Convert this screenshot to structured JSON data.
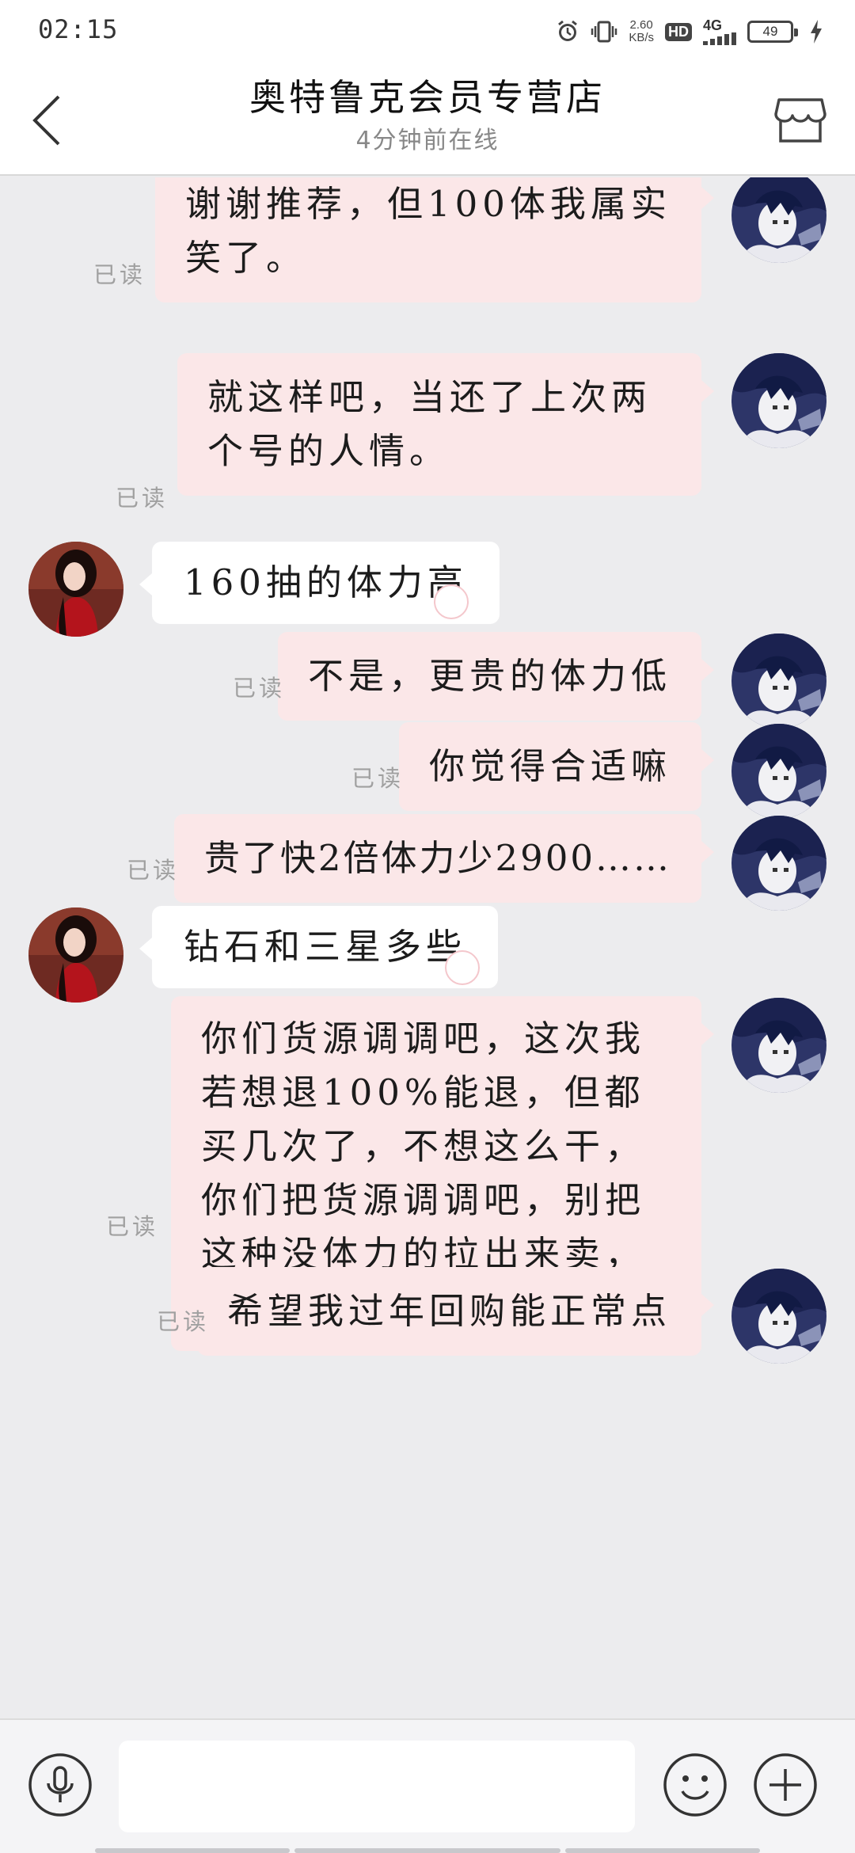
{
  "status_bar": {
    "time": "02:15",
    "net_speed_value": "2.60",
    "net_speed_unit": "KB/s",
    "hd_label": "HD",
    "network_type": "4G",
    "battery_level": "49"
  },
  "header": {
    "title": "奥特鲁克会员专营店",
    "status": "4分钟前在线"
  },
  "messages": [
    {
      "side": "out",
      "text": "谢谢推荐，但100体我属实笑了。",
      "status": "已读"
    },
    {
      "side": "out",
      "text": "就这样吧，当还了上次两个号的人情。",
      "status": "已读"
    },
    {
      "side": "in",
      "text": "160抽的体力高"
    },
    {
      "side": "out",
      "text": "不是，更贵的体力低",
      "status": "已读"
    },
    {
      "side": "out",
      "text": "你觉得合适嘛",
      "status": "已读"
    },
    {
      "side": "out",
      "text": "贵了快2倍体力少2900……",
      "status": "已读"
    },
    {
      "side": "in",
      "text": "钻石和三星多些"
    },
    {
      "side": "out",
      "text": "你们货源调调吧，这次我若想退100%能退，但都买几次了，不想这么干，你们把货源调调吧，别把这种没体力的拉出来卖，仲裁一退一个准",
      "status": "已读"
    },
    {
      "side": "out",
      "text": "希望我过年回购能正常点",
      "status": "已读"
    }
  ],
  "input_bar": {
    "placeholder": ""
  },
  "colors": {
    "outgoing_bubble": "#fbe7e8",
    "incoming_bubble": "#ffffff",
    "chat_background": "#ececee",
    "read_receipt": "#a0a0a0"
  },
  "icons": {
    "back": "chevron-left-icon",
    "store": "store-icon",
    "voice": "microphone-icon",
    "emoji": "smiley-icon",
    "plus": "plus-icon"
  }
}
